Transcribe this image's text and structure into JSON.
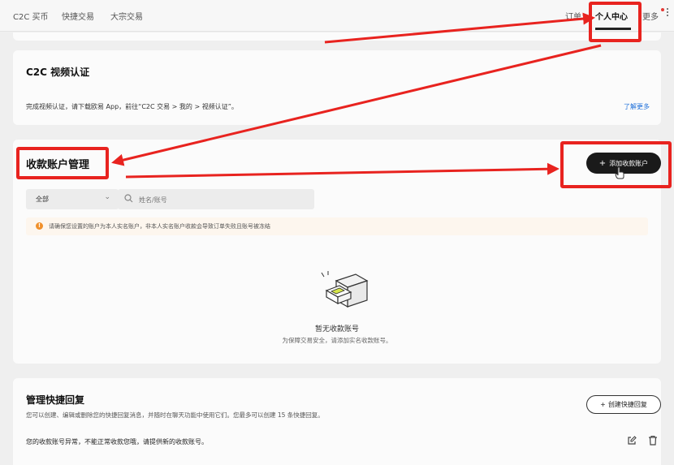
{
  "nav": {
    "items": [
      "C2C 买币",
      "快捷交易",
      "大宗交易"
    ],
    "orders": "订单",
    "user_center": "个人中心",
    "more": "更多"
  },
  "video_verify": {
    "title": "C2C 视频认证",
    "description": "完成视频认证，请下载欧易 App，前往“C2C 交易 > 我的 > 视频认证”。",
    "learn_more": "了解更多"
  },
  "accounts": {
    "title": "收款账户管理",
    "add_button": "添加收款账户",
    "filter_value": "全部",
    "search_placeholder": "姓名/账号",
    "notice": "请确保您设置的账户为本人实名账户，非本人实名账户收款会导致订单失败且账号被冻结",
    "empty_title": "暂无收款账号",
    "empty_subtitle": "为保障交易安全，请添加实名收款账号。"
  },
  "quick_reply": {
    "title": "管理快捷回复",
    "description": "您可以创建、编辑或删除您的快捷回复消息，并随时在聊天功能中使用它们。您最多可以创建 15 条快捷回复。",
    "create_button": "创建快捷回复",
    "row_text": "您的收款账号异常，不能正常收款您哦，请提供新的收款账号。"
  },
  "annotation_color": "#e8231f"
}
